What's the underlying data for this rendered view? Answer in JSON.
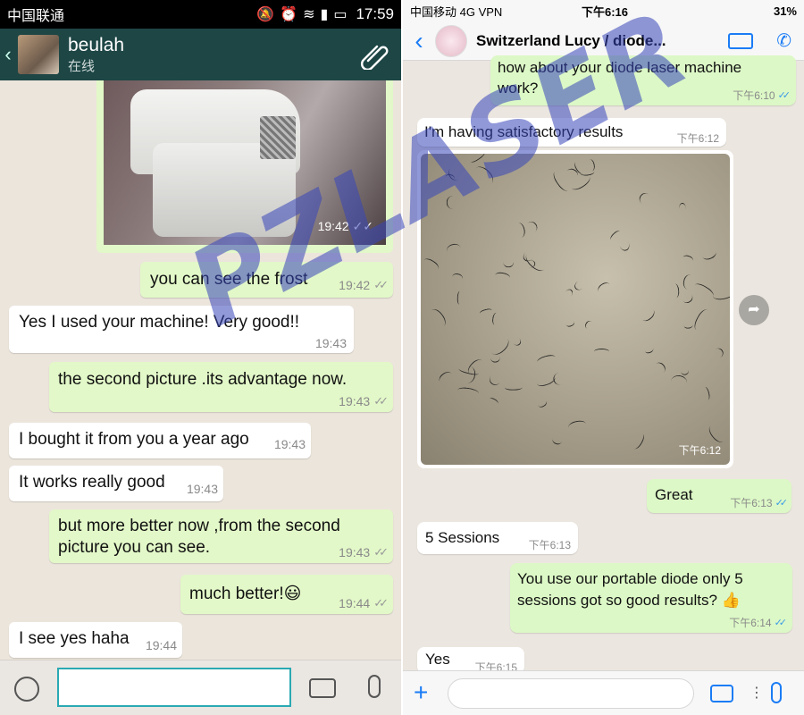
{
  "left_phone": {
    "status_bar": {
      "carrier": "中国联通",
      "time": "17:59"
    },
    "header": {
      "contact_name": "beulah",
      "contact_status": "在线"
    },
    "image_message": {
      "time": "19:42"
    },
    "messages": [
      {
        "dir": "out",
        "text": "you can see the frost",
        "time": "19:42",
        "ticks": "✓✓"
      },
      {
        "dir": "in",
        "text": "Yes I used your machine! Very good!!",
        "time": "19:43"
      },
      {
        "dir": "out",
        "text": "the second picture .its advantage now.",
        "time": "19:43",
        "ticks": "✓✓"
      },
      {
        "dir": "in",
        "text": "I bought it from you a year ago",
        "time": "19:43"
      },
      {
        "dir": "in",
        "text": "It works really good",
        "time": "19:43"
      },
      {
        "dir": "out",
        "text": "but more better now ,from the second picture you can see.",
        "time": "19:43",
        "ticks": "✓✓"
      },
      {
        "dir": "out",
        "text": "much better!😃",
        "time": "19:44",
        "ticks": "✓✓"
      },
      {
        "dir": "in",
        "text": "I see yes haha",
        "time": "19:44"
      }
    ]
  },
  "right_phone": {
    "status_bar": {
      "carrier": "中国移动 4G VPN",
      "time": "下午6:16",
      "battery": "31%"
    },
    "header": {
      "title": "Switzerland Lucy / diode..."
    },
    "messages": [
      {
        "dir": "out",
        "text": "how about your diode laser machine work?",
        "time": "下午6:10",
        "ticks": "✓✓"
      },
      {
        "dir": "in",
        "text": "I'm having satisfactory results",
        "time": "下午6:12"
      },
      {
        "dir": "out",
        "text": "Great",
        "time": "下午6:13",
        "ticks": "✓✓"
      },
      {
        "dir": "in",
        "text": "5 Sessions",
        "time": "下午6:13"
      },
      {
        "dir": "out",
        "text": "You use our portable diode only 5 sessions got so good results? 👍",
        "time": "下午6:14",
        "ticks": "✓✓"
      },
      {
        "dir": "in",
        "text": "Yes",
        "time": "下午6:15"
      }
    ],
    "image_message": {
      "time": "下午6:12"
    }
  },
  "watermark": {
    "text": "PZLASER"
  }
}
